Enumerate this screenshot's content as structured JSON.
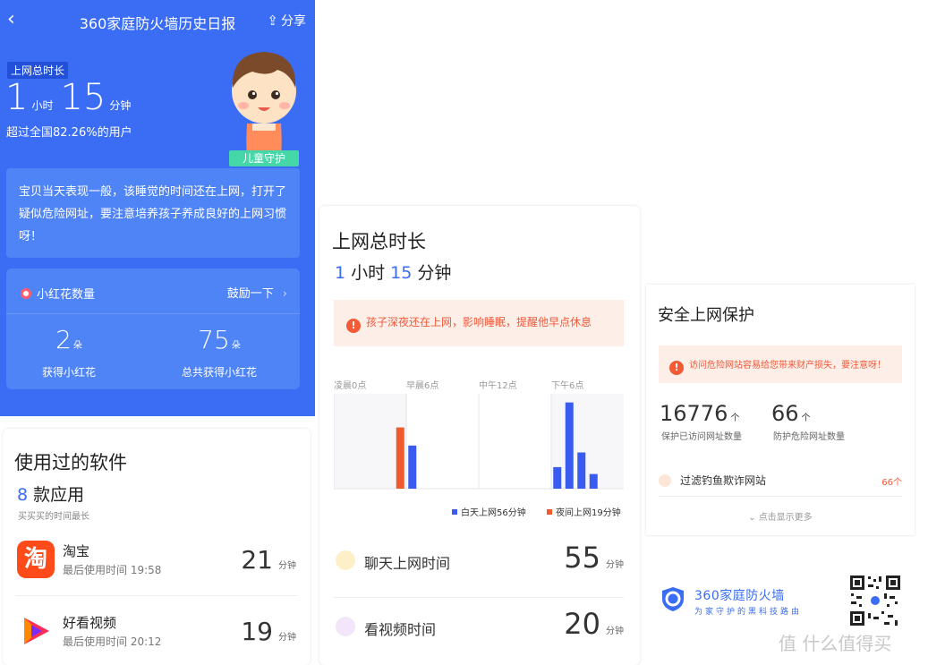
{
  "header": {
    "back_icon": "chevron-left-icon",
    "title": "360家庭防火墙历史日报",
    "share_label": "分享"
  },
  "summary": {
    "tag": "上网总时长",
    "hours": "1",
    "hours_unit": "小时",
    "minutes": "15",
    "minutes_unit": "分钟",
    "rank_text": "超过全国82.26%的用户",
    "badge": "儿童守护",
    "message": "宝贝当天表现一般，该睡觉的时间还在上网，打开了疑似危险网址，要注意培养孩子养成良好的上网习惯呀！"
  },
  "flowers": {
    "title": "小红花数量",
    "encourage": "鼓励一下",
    "got_value": "2",
    "got_unit": "朵",
    "got_label": "获得小红花",
    "total_value": "75",
    "total_unit": "朵",
    "total_label": "总共获得小红花"
  },
  "apps": {
    "title": "使用过的软件",
    "count": "8",
    "count_suffix": " 款应用",
    "subtitle": "买买买的时间最长",
    "items": [
      {
        "name": "淘宝",
        "last_used": "最后使用时间 19:58",
        "minutes": "21",
        "unit": "分钟"
      },
      {
        "name": "好看视频",
        "last_used": "最后使用时间 20:12",
        "minutes": "19",
        "unit": "分钟"
      }
    ],
    "taobao_badge": "淘"
  },
  "online": {
    "title": "上网总时长",
    "hours": "1",
    "hours_unit": " 小时",
    "minutes": "15",
    "minutes_unit": " 分钟",
    "warning": "孩子深夜还在上网，影响睡眠，提醒他早点休息",
    "chat_label": "聊天上网时间",
    "chat_value": "55",
    "video_label": "看视频时间",
    "video_value": "20",
    "unit": "分钟"
  },
  "chart_data": {
    "type": "bar",
    "x_tick_labels": [
      "凌晨0点",
      "早晨6点",
      "中午12点",
      "下午6点"
    ],
    "series": [
      {
        "name": "白天上网56分钟",
        "color": "#3a5bf0",
        "bars": [
          {
            "hour": 6.5,
            "value": 0.5
          },
          {
            "hour": 18.5,
            "value": 0.25
          },
          {
            "hour": 19.5,
            "value": 1.0
          },
          {
            "hour": 20.5,
            "value": 0.42
          },
          {
            "hour": 21.5,
            "value": 0.17
          }
        ]
      },
      {
        "name": "夜间上网19分钟",
        "color": "#f05a2c",
        "bars": [
          {
            "hour": 5.5,
            "value": 0.71
          }
        ]
      }
    ],
    "xlim": [
      0,
      24
    ],
    "ylim": [
      0,
      1.1
    ]
  },
  "security": {
    "title": "安全上网保护",
    "warning": "访问危险网站容易给您带来财产损失，要注意呀！",
    "visited_value": "16776",
    "visited_unit": "个",
    "visited_label": "保护已访问网址数量",
    "danger_value": "66",
    "danger_unit": "个",
    "danger_label": "防护危险网址数量",
    "filter_label": "过滤钓鱼欺诈网站",
    "filter_count": "66个",
    "more": "点击显示更多"
  },
  "brand": {
    "name": "360家庭防火墙",
    "slogan": "为家守护的黑科技路由",
    "watermark": "值 什么值得买"
  }
}
